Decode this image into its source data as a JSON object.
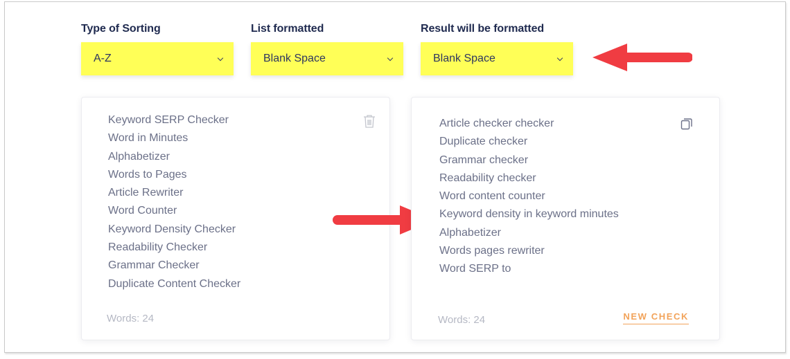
{
  "fields": [
    {
      "label": "Type of Sorting",
      "value": "A-Z"
    },
    {
      "label": "List formatted",
      "value": "Blank Space"
    },
    {
      "label": "Result will be formatted",
      "value": "Blank Space"
    }
  ],
  "input_panel": {
    "items": [
      "Keyword SERP Checker",
      "Word in Minutes",
      "Alphabetizer",
      "Words to Pages",
      "Article Rewriter",
      "Word Counter",
      "Keyword Density Checker",
      "Readability Checker",
      "Grammar Checker",
      "Duplicate Content Checker"
    ],
    "word_count": "Words: 24",
    "action_icon": "trash-icon"
  },
  "output_panel": {
    "items": [
      "Article checker checker",
      "Duplicate checker",
      "Grammar checker",
      "Readability checker",
      "Word content counter",
      "Keyword density in keyword minutes",
      "Alphabetizer",
      "Words pages rewriter",
      "Word SERP to"
    ],
    "word_count": "Words: 24",
    "action_icon": "copy-icon",
    "new_check_label": "NEW CHECK"
  },
  "colors": {
    "select_highlight": "#ffff57",
    "annotation_arrow": "#f03c42",
    "accent_link": "#f2a35a",
    "label_text": "#1f2a4f"
  }
}
